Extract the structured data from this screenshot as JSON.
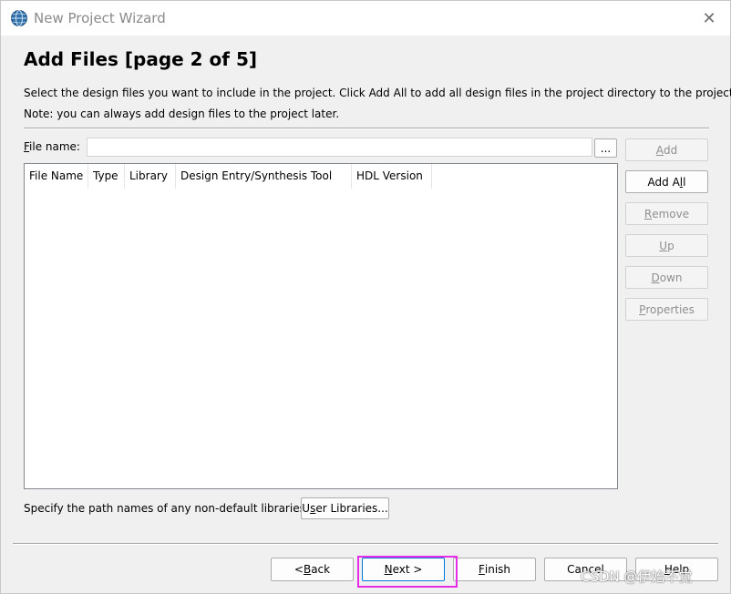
{
  "window": {
    "title": "New Project Wizard",
    "close_glyph": "✕",
    "icon": "quartus-globe-icon"
  },
  "page": {
    "heading": "Add Files [page 2 of 5]",
    "description": "Select the design files you want to include in the project. Click Add All to add all design files in the project directory to the project.",
    "note": "Note: you can always add design files to the project later."
  },
  "file_input": {
    "label_first": "F",
    "label_rest": "ile name:",
    "value": "",
    "browse_label": "..."
  },
  "side_buttons": {
    "add": {
      "first": "A",
      "rest": "dd"
    },
    "add_all": {
      "before": "Add A",
      "key": "l",
      "after": "l"
    },
    "remove": {
      "first": "R",
      "rest": "emove"
    },
    "up": {
      "first": "U",
      "rest": "p"
    },
    "down": {
      "first": "D",
      "rest": "own"
    },
    "properties": {
      "first": "P",
      "rest": "roperties"
    }
  },
  "table": {
    "columns": [
      "File Name",
      "Type",
      "Library",
      "Design Entry/Synthesis Tool",
      "HDL Version"
    ],
    "rows": []
  },
  "libraries": {
    "label": "Specify the path names of any non-default libraries.",
    "button": {
      "first": "U",
      "key": "s",
      "rest": "er Libraries..."
    }
  },
  "nav": {
    "back": {
      "prefix": "< ",
      "key": "B",
      "rest": "ack"
    },
    "next": {
      "key": "N",
      "rest": "ext >"
    },
    "finish": {
      "key": "F",
      "rest": "inish"
    },
    "cancel": {
      "label": "Cancel"
    },
    "help": {
      "key": "H",
      "rest": "elp"
    }
  },
  "watermark": "CSDN @伊始不觉",
  "colors": {
    "highlight": "#e62ce6",
    "default_button_border": "#0078d7"
  }
}
